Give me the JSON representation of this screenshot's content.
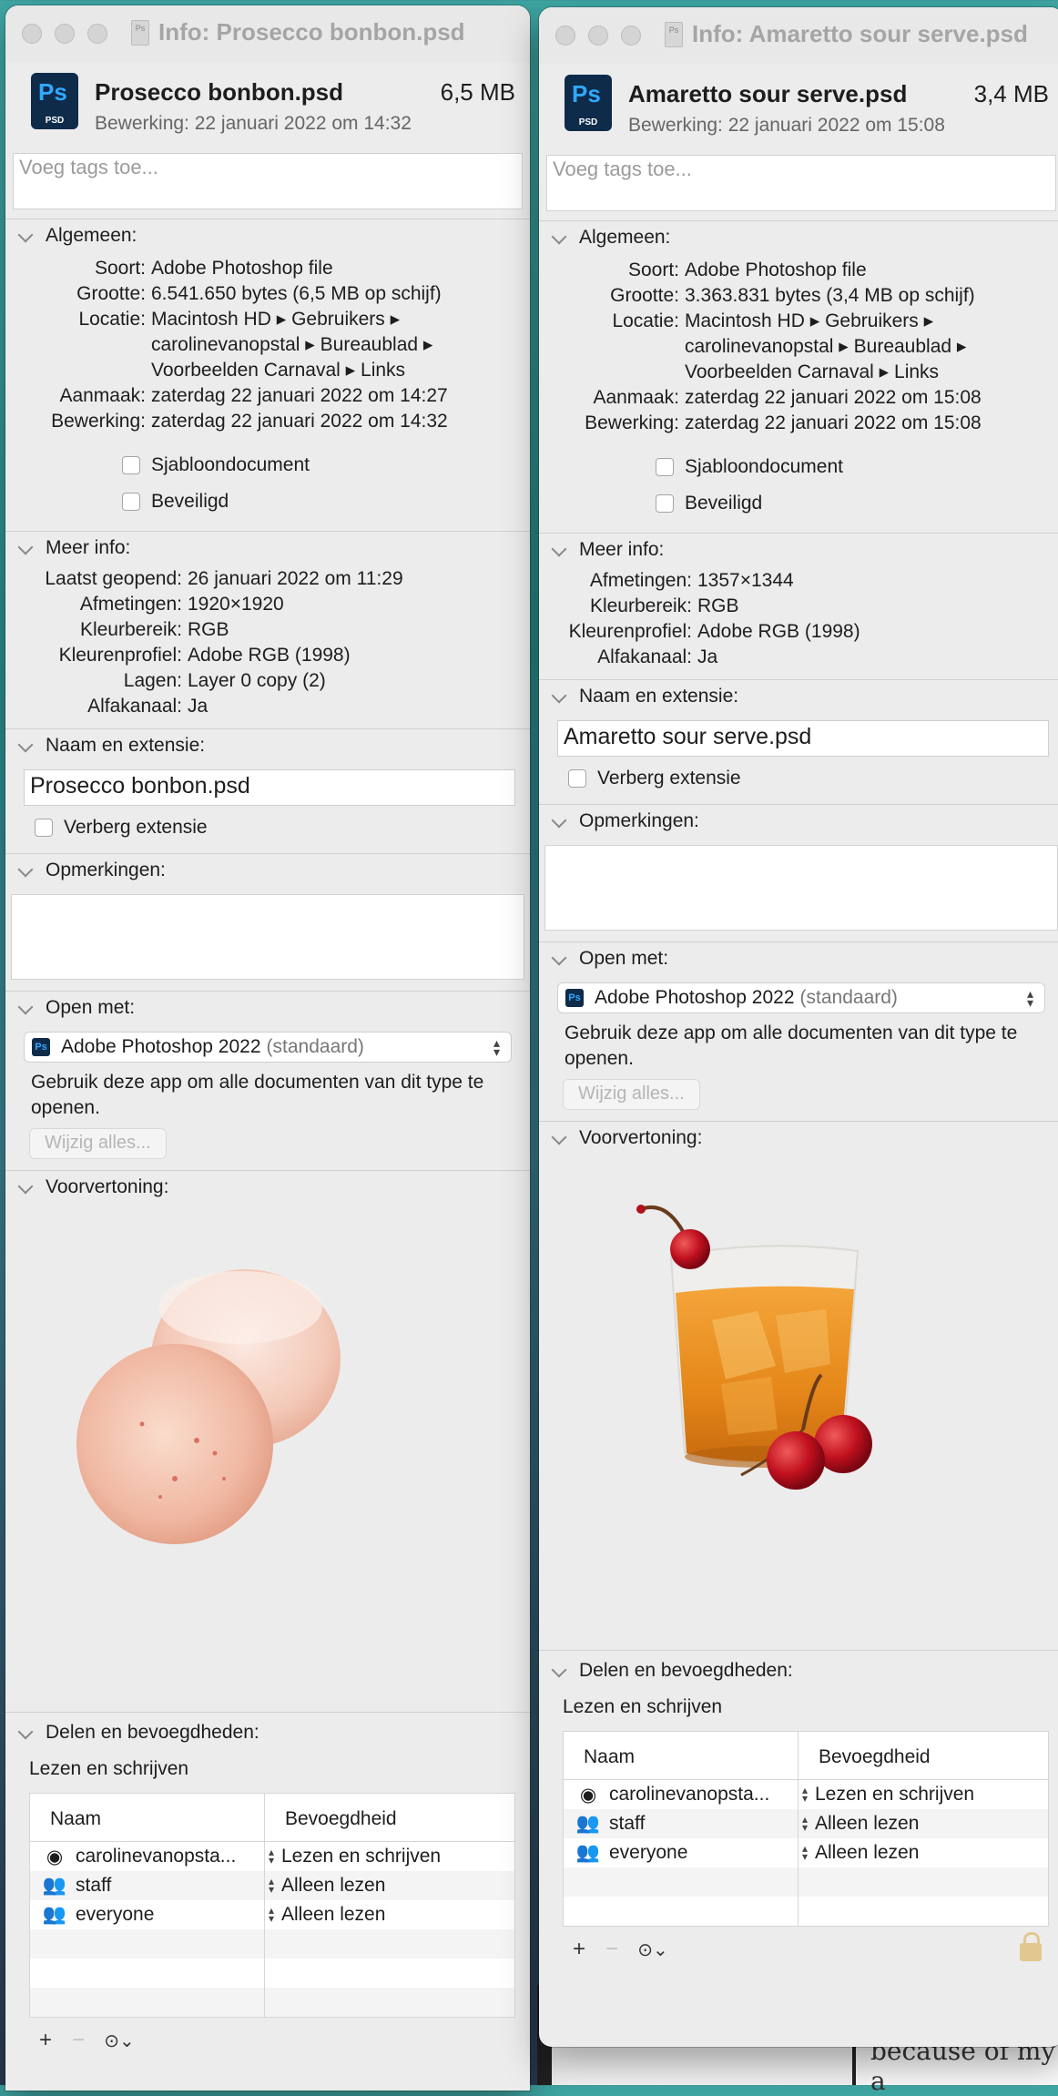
{
  "backdrop_text": "because of my a",
  "windows": [
    {
      "title": "Info: Prosecco bonbon.psd",
      "icon_ps": "Ps",
      "icon_psd": "PSD",
      "file_name": "Prosecco bonbon.psd",
      "file_size": "6,5 MB",
      "edit_line": "Bewerking: 22 januari 2022 om 14:32",
      "tags_placeholder": "Voeg tags toe...",
      "general": {
        "header": "Algemeen:",
        "rows": [
          {
            "k": "Soort:",
            "v": "Adobe Photoshop file"
          },
          {
            "k": "Grootte:",
            "v": "6.541.650 bytes (6,5 MB op schijf)"
          },
          {
            "k": "Locatie:",
            "v": "Macintosh HD ▸ Gebruikers ▸\ncarolinevanopstal ▸ Bureaublad ▸\nVoorbeelden Carnaval ▸ Links"
          },
          {
            "k": "Aanmaak:",
            "v": "zaterdag 22 januari 2022 om 14:27"
          },
          {
            "k": "Bewerking:",
            "v": "zaterdag 22 januari 2022 om 14:32"
          }
        ],
        "stationery": "Sjabloondocument",
        "locked": "Beveiligd"
      },
      "more_info": {
        "header": "Meer info:",
        "rows": [
          {
            "k": "Laatst geopend:",
            "v": "26 januari 2022 om 11:29"
          },
          {
            "k": "Afmetingen:",
            "v": "1920×1920"
          },
          {
            "k": "Kleurbereik:",
            "v": "RGB"
          },
          {
            "k": "Kleurenprofiel:",
            "v": "Adobe RGB (1998)"
          },
          {
            "k": "Lagen:",
            "v": "Layer 0 copy (2)"
          },
          {
            "k": "Alfakanaal:",
            "v": "Ja"
          }
        ]
      },
      "name_ext": {
        "header": "Naam en extensie:",
        "value": "Prosecco bonbon.psd",
        "hide_ext": "Verberg extensie"
      },
      "comments_header": "Opmerkingen:",
      "open_with": {
        "header": "Open met:",
        "app": "Adobe Photoshop 2022",
        "std": "(standaard)",
        "desc": "Gebruik deze app om alle documenten van dit type te openen.",
        "change_all": "Wijzig alles..."
      },
      "preview_header": "Voorvertoning:",
      "sharing": {
        "header": "Delen en bevoegdheden:",
        "access": "Lezen en schrijven",
        "col_name": "Naam",
        "col_priv": "Bevoegdheid",
        "rows": [
          {
            "name": "carolinevanopsta...",
            "priv": "Lezen en schrijven",
            "icon": "person-icon"
          },
          {
            "name": "staff",
            "priv": "Alleen lezen",
            "icon": "group-icon"
          },
          {
            "name": "everyone",
            "priv": "Alleen lezen",
            "icon": "everyone-icon"
          }
        ]
      }
    },
    {
      "title": "Info: Amaretto sour serve.psd",
      "icon_ps": "Ps",
      "icon_psd": "PSD",
      "file_name": "Amaretto sour serve.psd",
      "file_size": "3,4 MB",
      "edit_line": "Bewerking: 22 januari 2022 om 15:08",
      "tags_placeholder": "Voeg tags toe...",
      "general": {
        "header": "Algemeen:",
        "rows": [
          {
            "k": "Soort:",
            "v": "Adobe Photoshop file"
          },
          {
            "k": "Grootte:",
            "v": "3.363.831 bytes (3,4 MB op schijf)"
          },
          {
            "k": "Locatie:",
            "v": "Macintosh HD ▸ Gebruikers ▸\ncarolinevanopstal ▸ Bureaublad ▸\nVoorbeelden Carnaval ▸ Links"
          },
          {
            "k": "Aanmaak:",
            "v": "zaterdag 22 januari 2022 om 15:08"
          },
          {
            "k": "Bewerking:",
            "v": "zaterdag 22 januari 2022 om 15:08"
          }
        ],
        "stationery": "Sjabloondocument",
        "locked": "Beveiligd"
      },
      "more_info": {
        "header": "Meer info:",
        "rows": [
          {
            "k": "Afmetingen:",
            "v": "1357×1344"
          },
          {
            "k": "Kleurbereik:",
            "v": "RGB"
          },
          {
            "k": "Kleurenprofiel:",
            "v": "Adobe RGB (1998)"
          },
          {
            "k": "Alfakanaal:",
            "v": "Ja"
          }
        ]
      },
      "name_ext": {
        "header": "Naam en extensie:",
        "value": "Amaretto sour serve.psd",
        "hide_ext": "Verberg extensie"
      },
      "comments_header": "Opmerkingen:",
      "open_with": {
        "header": "Open met:",
        "app": "Adobe Photoshop 2022",
        "std": "(standaard)",
        "desc": "Gebruik deze app om alle documenten van dit type te openen.",
        "change_all": "Wijzig alles..."
      },
      "preview_header": "Voorvertoning:",
      "sharing": {
        "header": "Delen en bevoegdheden:",
        "access": "Lezen en schrijven",
        "col_name": "Naam",
        "col_priv": "Bevoegdheid",
        "rows": [
          {
            "name": "carolinevanopsta...",
            "priv": "Lezen en schrijven",
            "icon": "person-icon"
          },
          {
            "name": "staff",
            "priv": "Alleen lezen",
            "icon": "group-icon"
          },
          {
            "name": "everyone",
            "priv": "Alleen lezen",
            "icon": "everyone-icon"
          }
        ]
      }
    }
  ]
}
